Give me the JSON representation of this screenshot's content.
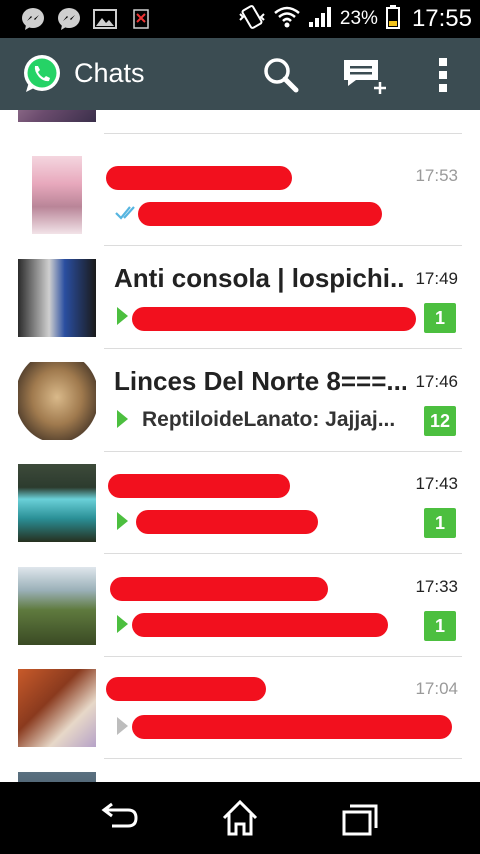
{
  "status_bar": {
    "battery_percent": "23%",
    "clock": "17:55",
    "icons": [
      "messenger-icon",
      "messenger-icon",
      "gallery-icon",
      "sim-icon",
      "vibrate-icon",
      "wifi-icon",
      "signal-icon",
      "battery-icon"
    ]
  },
  "action_bar": {
    "title": "Chats",
    "icons": [
      "whatsapp-logo-icon",
      "search-icon",
      "new-chat-icon",
      "overflow-menu-icon"
    ],
    "color": "#3b4c52"
  },
  "chats": [
    {
      "name": "",
      "preview": "",
      "time": "",
      "badge": "",
      "status": "sent-check"
    },
    {
      "name": "",
      "preview": "",
      "time": "17:53",
      "badge": "",
      "status": "read-double-check"
    },
    {
      "name": "Anti consola | lospichi...",
      "preview": "",
      "time": "17:49",
      "badge": "1",
      "status": "unread-arrow"
    },
    {
      "name": "Linces Del Norte  8===...",
      "preview": "ReptiloideLanato: Jajjaj...",
      "time": "17:46",
      "badge": "12",
      "status": "unread-arrow"
    },
    {
      "name": "",
      "preview": "",
      "time": "17:43",
      "badge": "1",
      "status": "unread-arrow"
    },
    {
      "name": "",
      "preview": "",
      "time": "17:33",
      "badge": "1",
      "status": "unread-arrow"
    },
    {
      "name": "",
      "preview": "",
      "time": "17:04",
      "badge": "",
      "status": "read-arrow"
    },
    {
      "name": "",
      "preview": "",
      "time": "",
      "badge": "",
      "status": ""
    }
  ],
  "colors": {
    "accent_green": "#4cbf3f",
    "redaction": "#f2101e"
  },
  "nav_bar": {
    "icons": [
      "back-icon",
      "home-icon",
      "recents-icon"
    ]
  }
}
